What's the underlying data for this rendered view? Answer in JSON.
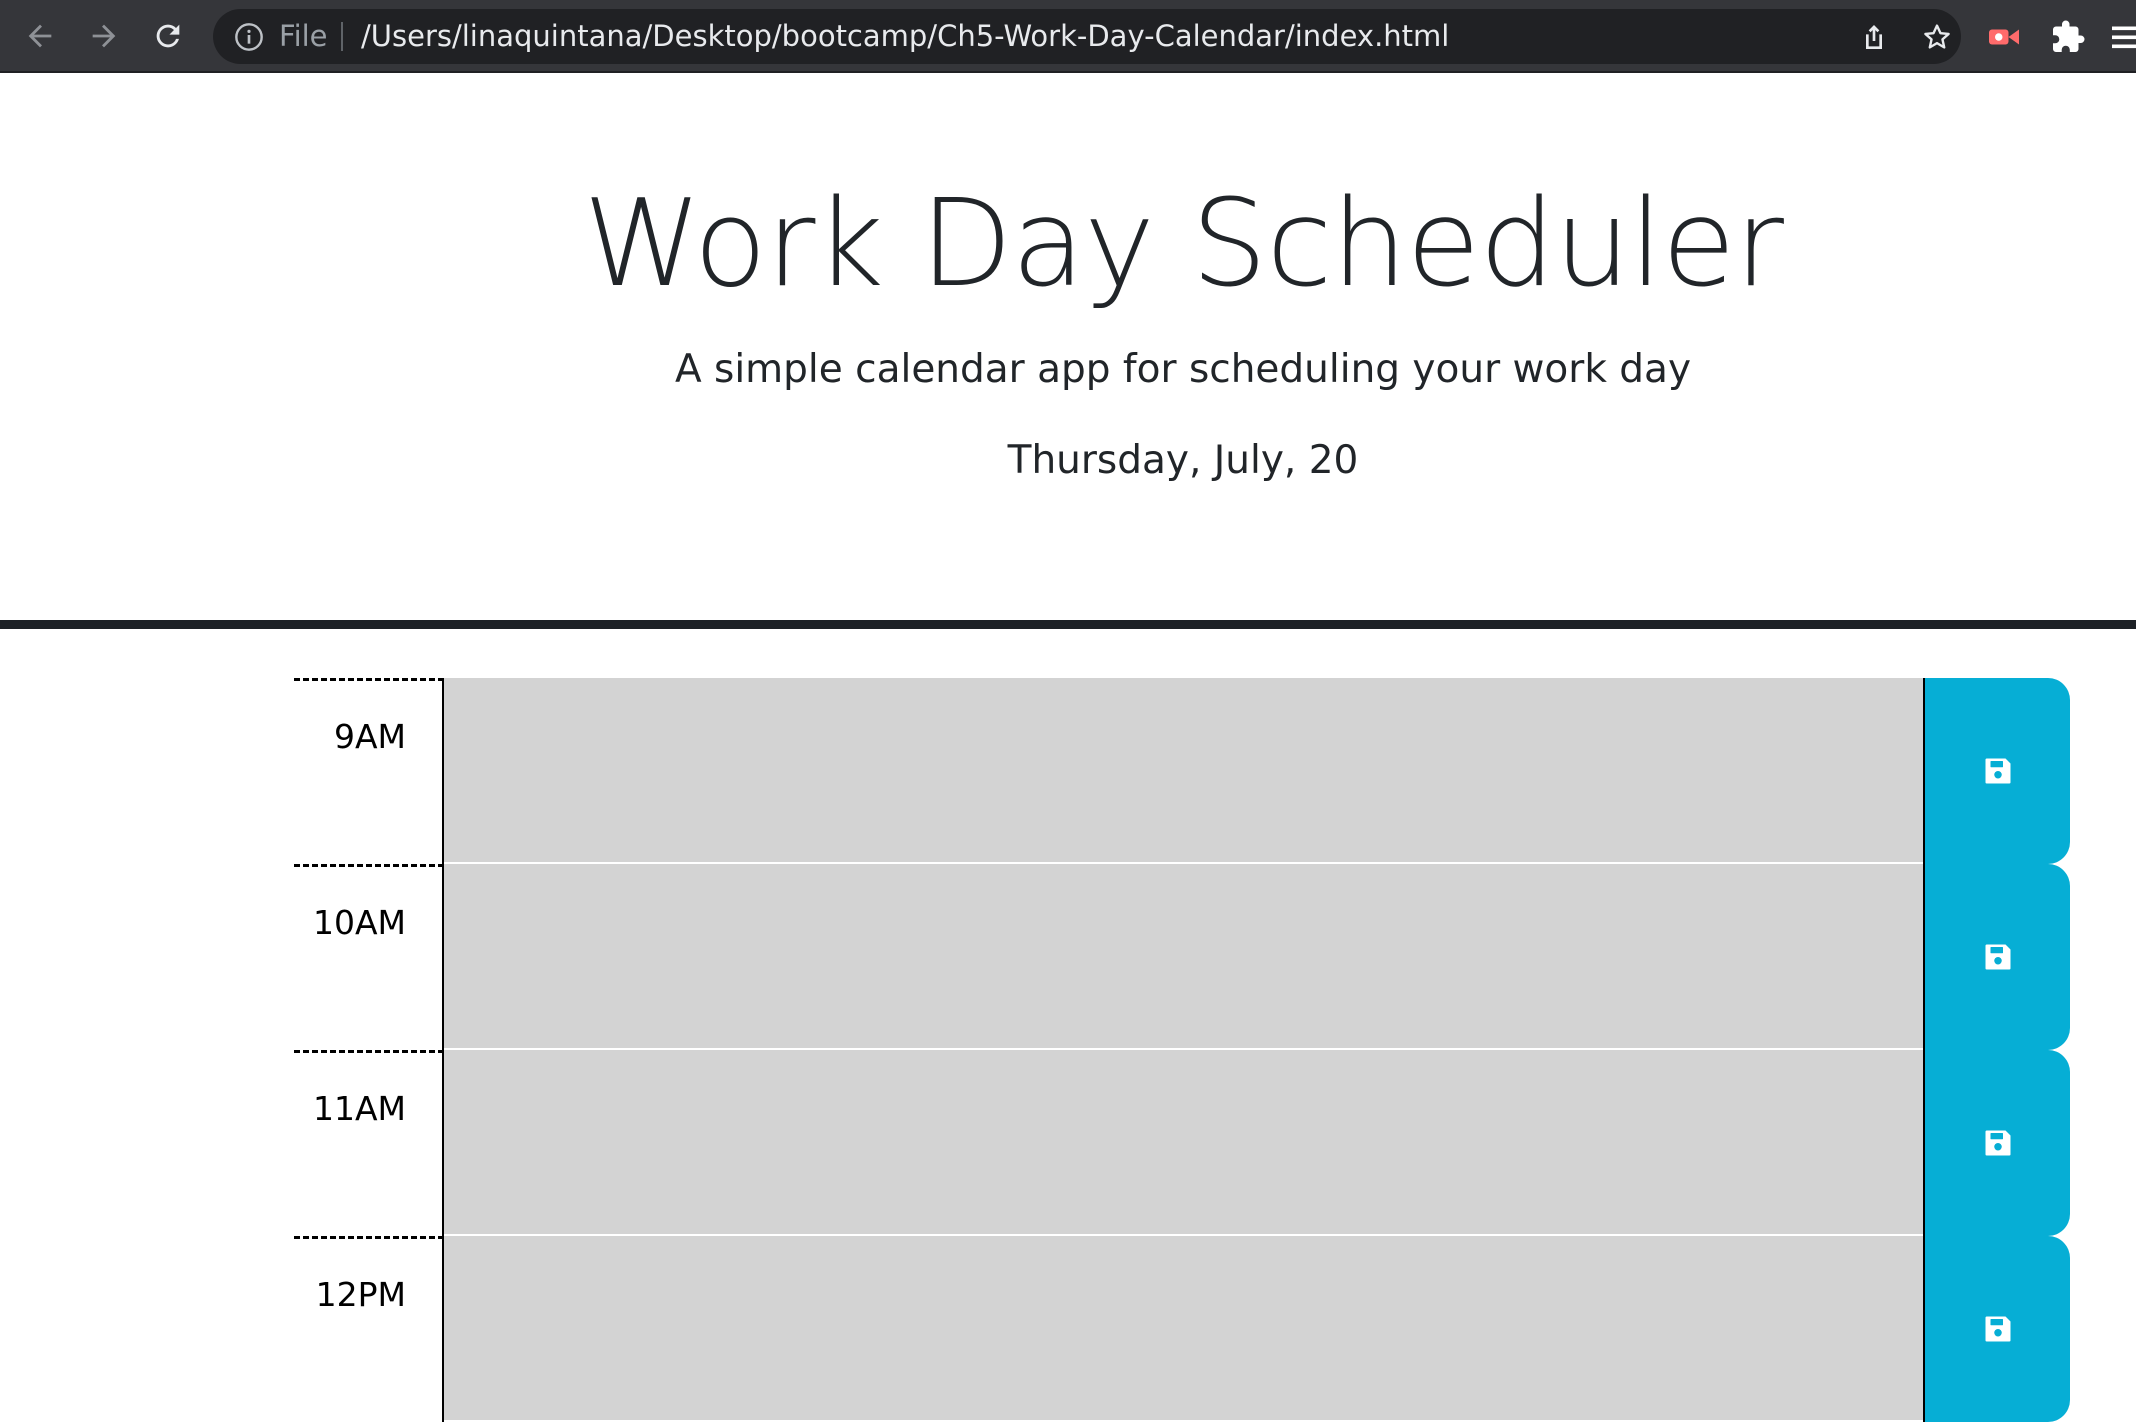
{
  "browser": {
    "scheme": "File",
    "url": "/Users/linaquintana/Desktop/bootcamp/Ch5-Work-Day-Calendar/index.html",
    "colors": {
      "toolbar": "#35363a",
      "omnibox": "#202124",
      "icon": "#bdc1c6"
    }
  },
  "header": {
    "title": "Work Day Scheduler",
    "lead": "A simple calendar app for scheduling your work day",
    "current_day": "Thursday, July, 20"
  },
  "schedule": {
    "rows": [
      {
        "hour": "9AM",
        "text": ""
      },
      {
        "hour": "10AM",
        "text": ""
      },
      {
        "hour": "11AM",
        "text": ""
      },
      {
        "hour": "12PM",
        "text": ""
      }
    ],
    "colors": {
      "past": "#d3d3d3",
      "save_button": "#06aed5"
    },
    "save_icon": "floppy-disk-icon"
  }
}
